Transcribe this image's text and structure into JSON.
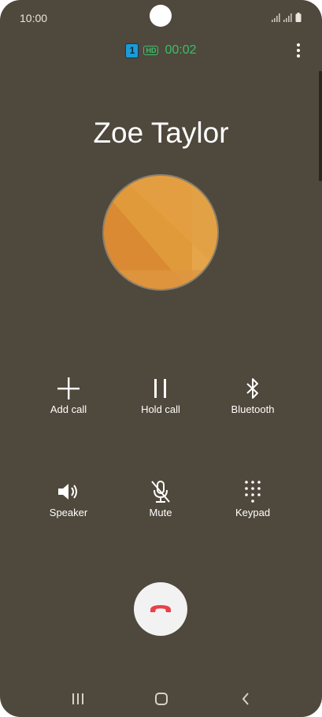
{
  "status_bar": {
    "time": "10:00",
    "icons": [
      "signal-icon",
      "signal-icon",
      "battery-icon"
    ]
  },
  "call": {
    "sim_slot": "1",
    "hd_label": "HD",
    "timer": "00:02",
    "contact_name": "Zoe Taylor"
  },
  "actions": {
    "add_call": "Add call",
    "hold_call": "Hold call",
    "bluetooth": "Bluetooth",
    "speaker": "Speaker",
    "mute": "Mute",
    "keypad": "Keypad"
  },
  "colors": {
    "background": "#4f483c",
    "timer_green": "#3bbf6a",
    "end_call_red": "#e8414a",
    "avatar_orange": "#e09a3a"
  },
  "navigation": {
    "buttons": [
      "recents-icon",
      "home-icon",
      "back-icon"
    ]
  }
}
